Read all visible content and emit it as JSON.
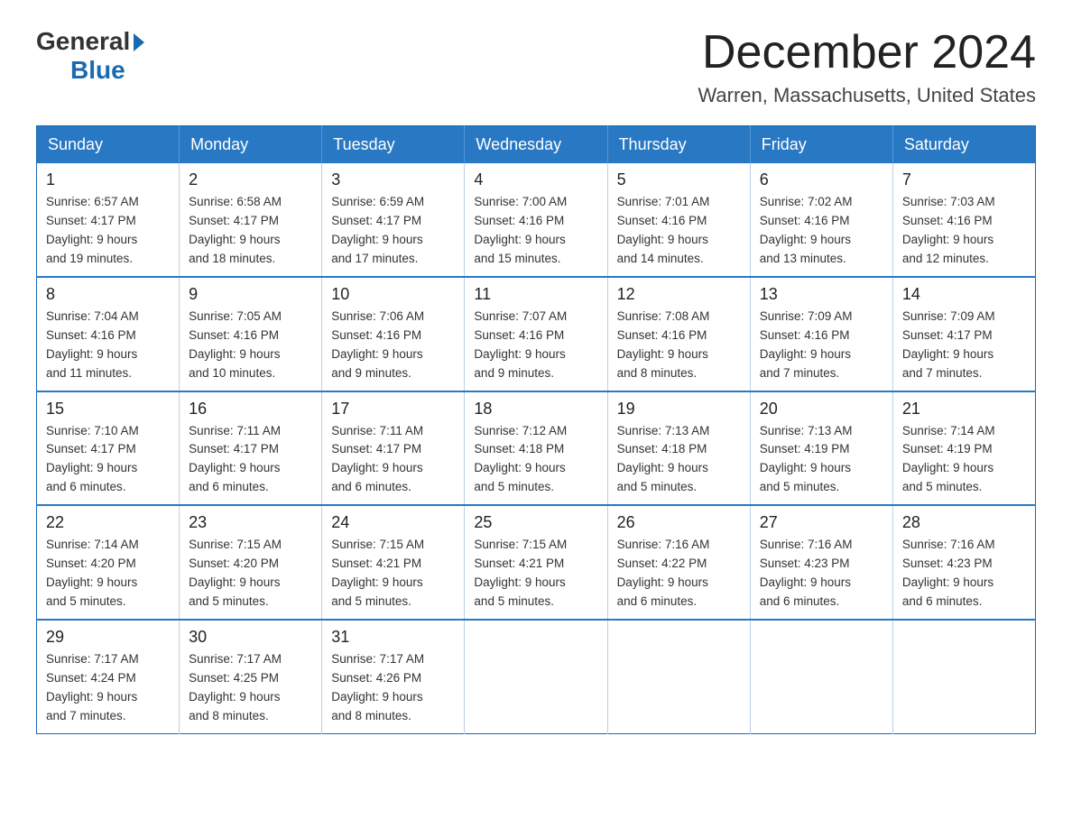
{
  "logo": {
    "general": "General",
    "blue": "Blue"
  },
  "title": {
    "month": "December 2024",
    "location": "Warren, Massachusetts, United States"
  },
  "header_days": [
    "Sunday",
    "Monday",
    "Tuesday",
    "Wednesday",
    "Thursday",
    "Friday",
    "Saturday"
  ],
  "weeks": [
    [
      {
        "day": "1",
        "sunrise": "6:57 AM",
        "sunset": "4:17 PM",
        "daylight": "9 hours and 19 minutes."
      },
      {
        "day": "2",
        "sunrise": "6:58 AM",
        "sunset": "4:17 PM",
        "daylight": "9 hours and 18 minutes."
      },
      {
        "day": "3",
        "sunrise": "6:59 AM",
        "sunset": "4:17 PM",
        "daylight": "9 hours and 17 minutes."
      },
      {
        "day": "4",
        "sunrise": "7:00 AM",
        "sunset": "4:16 PM",
        "daylight": "9 hours and 15 minutes."
      },
      {
        "day": "5",
        "sunrise": "7:01 AM",
        "sunset": "4:16 PM",
        "daylight": "9 hours and 14 minutes."
      },
      {
        "day": "6",
        "sunrise": "7:02 AM",
        "sunset": "4:16 PM",
        "daylight": "9 hours and 13 minutes."
      },
      {
        "day": "7",
        "sunrise": "7:03 AM",
        "sunset": "4:16 PM",
        "daylight": "9 hours and 12 minutes."
      }
    ],
    [
      {
        "day": "8",
        "sunrise": "7:04 AM",
        "sunset": "4:16 PM",
        "daylight": "9 hours and 11 minutes."
      },
      {
        "day": "9",
        "sunrise": "7:05 AM",
        "sunset": "4:16 PM",
        "daylight": "9 hours and 10 minutes."
      },
      {
        "day": "10",
        "sunrise": "7:06 AM",
        "sunset": "4:16 PM",
        "daylight": "9 hours and 9 minutes."
      },
      {
        "day": "11",
        "sunrise": "7:07 AM",
        "sunset": "4:16 PM",
        "daylight": "9 hours and 9 minutes."
      },
      {
        "day": "12",
        "sunrise": "7:08 AM",
        "sunset": "4:16 PM",
        "daylight": "9 hours and 8 minutes."
      },
      {
        "day": "13",
        "sunrise": "7:09 AM",
        "sunset": "4:16 PM",
        "daylight": "9 hours and 7 minutes."
      },
      {
        "day": "14",
        "sunrise": "7:09 AM",
        "sunset": "4:17 PM",
        "daylight": "9 hours and 7 minutes."
      }
    ],
    [
      {
        "day": "15",
        "sunrise": "7:10 AM",
        "sunset": "4:17 PM",
        "daylight": "9 hours and 6 minutes."
      },
      {
        "day": "16",
        "sunrise": "7:11 AM",
        "sunset": "4:17 PM",
        "daylight": "9 hours and 6 minutes."
      },
      {
        "day": "17",
        "sunrise": "7:11 AM",
        "sunset": "4:17 PM",
        "daylight": "9 hours and 6 minutes."
      },
      {
        "day": "18",
        "sunrise": "7:12 AM",
        "sunset": "4:18 PM",
        "daylight": "9 hours and 5 minutes."
      },
      {
        "day": "19",
        "sunrise": "7:13 AM",
        "sunset": "4:18 PM",
        "daylight": "9 hours and 5 minutes."
      },
      {
        "day": "20",
        "sunrise": "7:13 AM",
        "sunset": "4:19 PM",
        "daylight": "9 hours and 5 minutes."
      },
      {
        "day": "21",
        "sunrise": "7:14 AM",
        "sunset": "4:19 PM",
        "daylight": "9 hours and 5 minutes."
      }
    ],
    [
      {
        "day": "22",
        "sunrise": "7:14 AM",
        "sunset": "4:20 PM",
        "daylight": "9 hours and 5 minutes."
      },
      {
        "day": "23",
        "sunrise": "7:15 AM",
        "sunset": "4:20 PM",
        "daylight": "9 hours and 5 minutes."
      },
      {
        "day": "24",
        "sunrise": "7:15 AM",
        "sunset": "4:21 PM",
        "daylight": "9 hours and 5 minutes."
      },
      {
        "day": "25",
        "sunrise": "7:15 AM",
        "sunset": "4:21 PM",
        "daylight": "9 hours and 5 minutes."
      },
      {
        "day": "26",
        "sunrise": "7:16 AM",
        "sunset": "4:22 PM",
        "daylight": "9 hours and 6 minutes."
      },
      {
        "day": "27",
        "sunrise": "7:16 AM",
        "sunset": "4:23 PM",
        "daylight": "9 hours and 6 minutes."
      },
      {
        "day": "28",
        "sunrise": "7:16 AM",
        "sunset": "4:23 PM",
        "daylight": "9 hours and 6 minutes."
      }
    ],
    [
      {
        "day": "29",
        "sunrise": "7:17 AM",
        "sunset": "4:24 PM",
        "daylight": "9 hours and 7 minutes."
      },
      {
        "day": "30",
        "sunrise": "7:17 AM",
        "sunset": "4:25 PM",
        "daylight": "9 hours and 8 minutes."
      },
      {
        "day": "31",
        "sunrise": "7:17 AM",
        "sunset": "4:26 PM",
        "daylight": "9 hours and 8 minutes."
      },
      null,
      null,
      null,
      null
    ]
  ],
  "labels": {
    "sunrise": "Sunrise:",
    "sunset": "Sunset:",
    "daylight": "Daylight:"
  }
}
